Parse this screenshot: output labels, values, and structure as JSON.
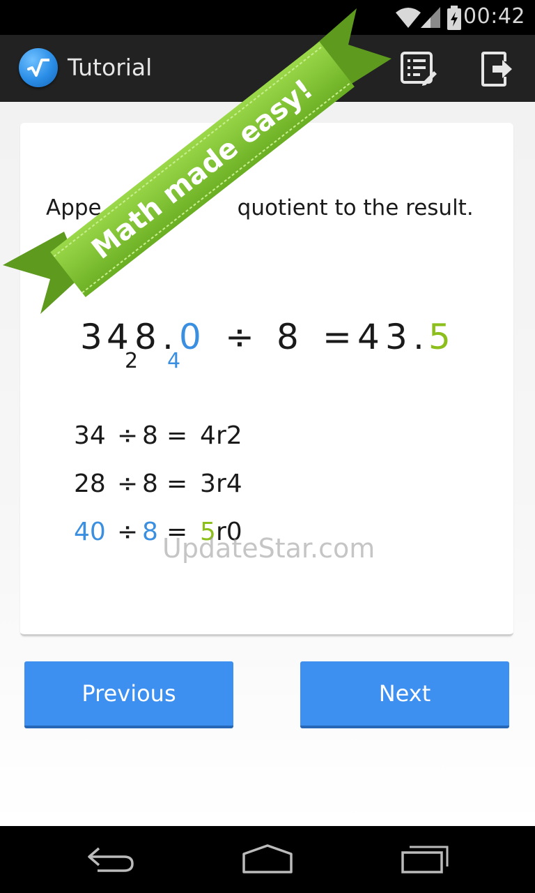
{
  "status_bar": {
    "time": "00:42",
    "icons": [
      "wifi-icon",
      "signal-icon",
      "battery-icon"
    ]
  },
  "action_bar": {
    "title": "Tutorial",
    "logo_icon": "square-root-icon",
    "actions": [
      "notes-icon",
      "exit-icon"
    ]
  },
  "ribbon": {
    "text": "Math made easy!",
    "color": "#7cc52d"
  },
  "card": {
    "instruction_start": "Appe",
    "instruction_end": "quotient to the result.",
    "equation": {
      "d1": "3",
      "d2": "4",
      "sub2": "2",
      "d3": "8",
      "dot1": ".",
      "d4": "0",
      "sub4": "4",
      "op": "÷",
      "divisor": "8",
      "eq": "=",
      "r1": "4",
      "r2": "3",
      "dot2": ".",
      "r3": "5"
    },
    "steps": [
      {
        "a": "34",
        "op": "÷",
        "b": "8",
        "eq": "=",
        "q": "4",
        "r": "r2"
      },
      {
        "a": "28",
        "op": "÷",
        "b": "8",
        "eq": "=",
        "q": "3",
        "r": "r4"
      },
      {
        "a": "40",
        "op": "÷",
        "b": "8",
        "eq": "=",
        "q": "5",
        "r": "r0"
      }
    ]
  },
  "watermark": "UpdateStar.com",
  "buttons": {
    "previous": "Previous",
    "next": "Next"
  },
  "colors": {
    "accent_blue": "#3a8fe0",
    "accent_green": "#8cbf1c",
    "button_blue": "#3d8ff0"
  },
  "nav_bar": {
    "icons": [
      "back-icon",
      "home-icon",
      "recent-apps-icon"
    ]
  }
}
